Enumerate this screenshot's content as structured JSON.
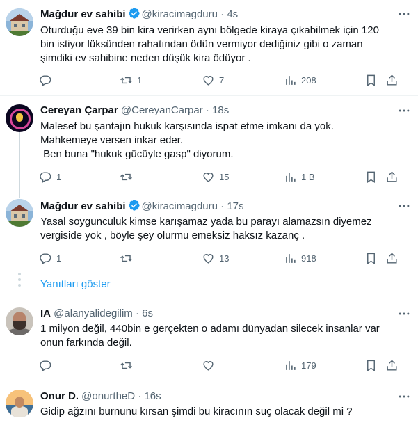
{
  "tweets": [
    {
      "name": "Mağdur ev sahibi",
      "handle": "@kiracimagduru",
      "time": "4s",
      "verified": true,
      "text": "Oturduğu eve 39 bin kira verirken aynı bölgede kiraya çıkabilmek için 120\nbin istiyor lüksünden rahatından ödün vermiyor dediğiniz gibi o zaman\nşimdiki ev sahibine neden düşük kira ödüyor .",
      "replies": "",
      "retweets": "1",
      "likes": "7",
      "views": "208"
    },
    {
      "name": "Cereyan Çarpar",
      "handle": "@CereyanCarpar",
      "time": "18s",
      "verified": false,
      "text": "Malesef bu şantajın hukuk karşısında ispat etme imkanı da yok.\nMahkemeye versen inkar eder.\n Ben buna \"hukuk gücüyle gasp\" diyorum.",
      "replies": "1",
      "retweets": "",
      "likes": "15",
      "views": "1 B"
    },
    {
      "name": "Mağdur ev sahibi",
      "handle": "@kiracimagduru",
      "time": "17s",
      "verified": true,
      "text": "Yasal soygunculuk kimse karışamaz yada bu parayı alamazsın diyemez\nvergiside yok , böyle şey olurmu emeksiz haksız kazanç .",
      "replies": "1",
      "retweets": "",
      "likes": "13",
      "views": "918"
    },
    {
      "name": "IA",
      "handle": "@alanyalidegilim",
      "time": "6s",
      "verified": false,
      "text": "1 milyon değil, 440bin e gerçekten o adamı dünyadan silecek insanlar var\nonun farkında değil.",
      "replies": "",
      "retweets": "",
      "likes": "",
      "views": "179"
    },
    {
      "name": "Onur D.",
      "handle": "@onurtheD",
      "time": "16s",
      "verified": false,
      "text": "Gidip ağzını burnunu kırsan şimdi bu kiracının suç olacak değil mi ?",
      "replies": "",
      "retweets": "",
      "likes": "",
      "views": ""
    }
  ],
  "show_replies": "Yanıtları göster",
  "sep": " · ",
  "icons": {
    "reply": "reply-icon",
    "retweet": "retweet-icon",
    "like": "heart-icon",
    "views": "views-icon",
    "bookmark": "bookmark-icon",
    "share": "share-icon",
    "more": "more-icon",
    "verified": "verified-badge-icon"
  },
  "colors": {
    "accent": "#1d9bf0",
    "text": "#0f1419",
    "muted": "#536471",
    "divider": "#eff3f4"
  }
}
